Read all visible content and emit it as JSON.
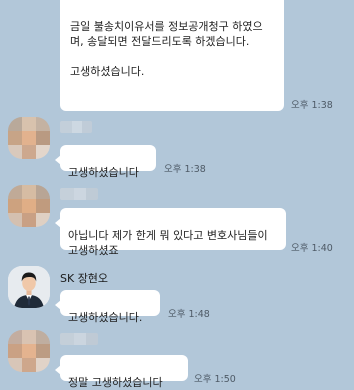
{
  "colors": {
    "chat_background": "#b2c7d9",
    "bubble": "#ffffff",
    "time_text": "#4e5a66"
  },
  "messages": [
    {
      "sender": "",
      "text": "금일 불송치이유서를 정보공개청구 하였으며, 송달되면 전달드리도록 하겠습니다.\n\n고생하셨습니다.",
      "time": "오후 1:38"
    },
    {
      "sender": "",
      "text": "고생하셨습니다",
      "time": "오후 1:38"
    },
    {
      "sender": "",
      "text": "아닙니다 제가 한게 뭐 있다고 변호사님들이 고생하셨죠",
      "time": "오후 1:40"
    },
    {
      "sender": "SK 장현오",
      "text": "고생하셨습니다.",
      "time": "오후 1:48"
    },
    {
      "sender": "",
      "text": "정말 고생하셨습니다",
      "time": "오후 1:50"
    }
  ]
}
